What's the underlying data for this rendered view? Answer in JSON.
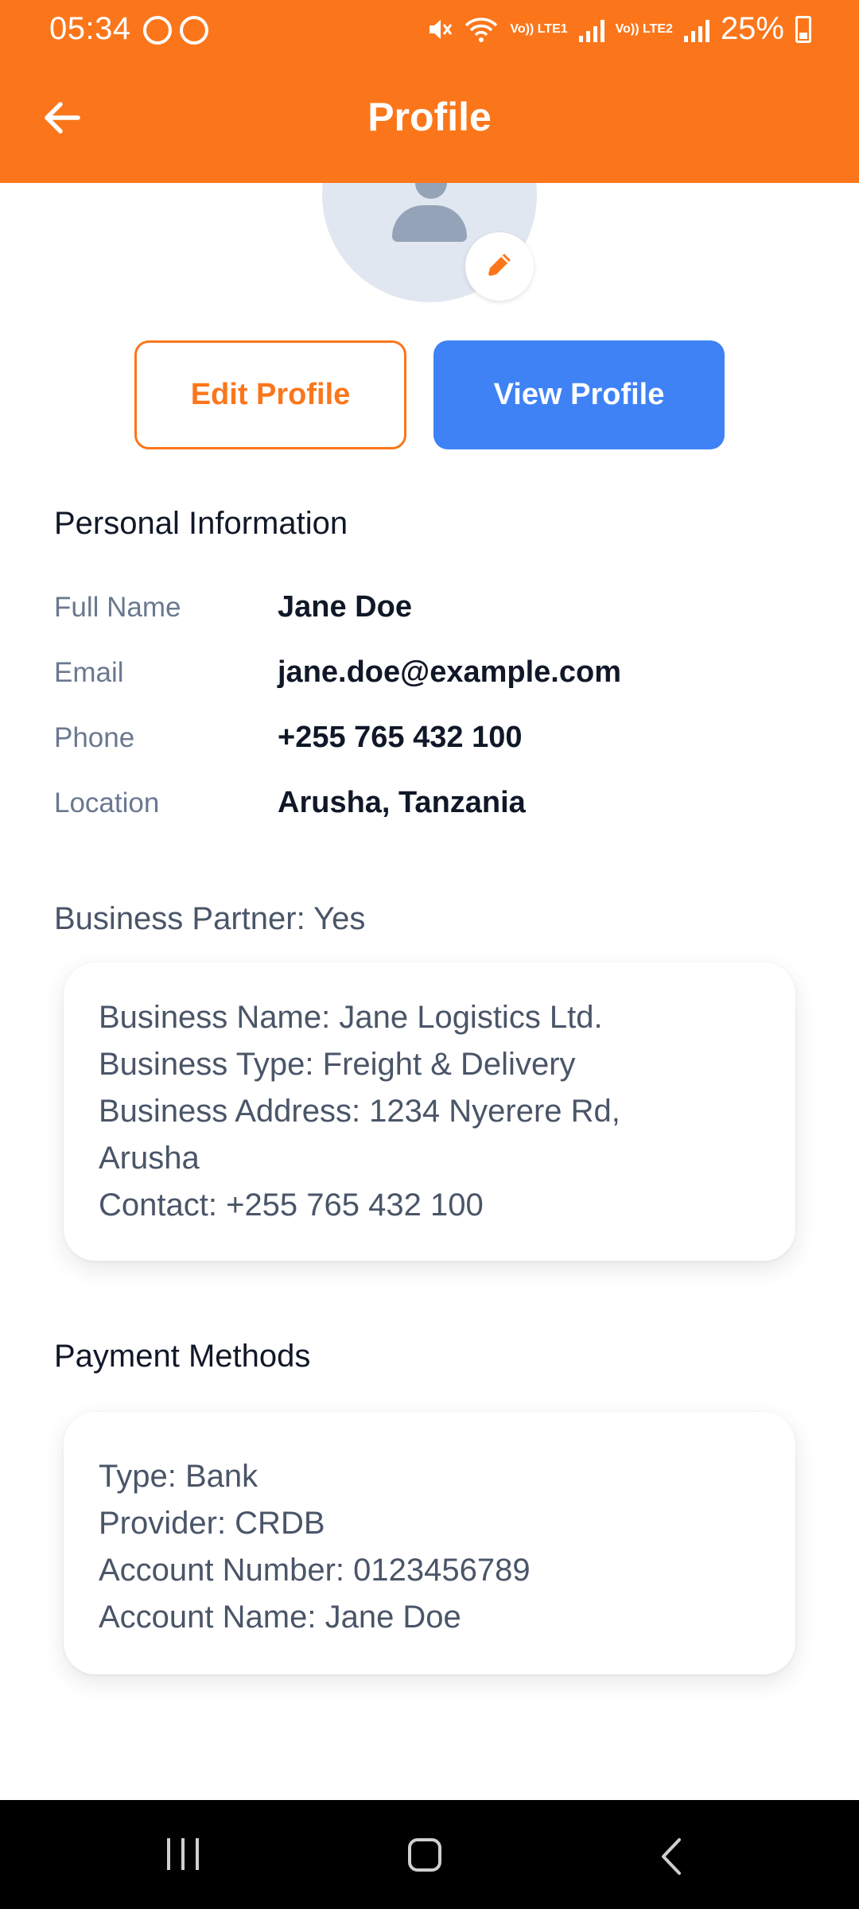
{
  "status_bar": {
    "time": "05:34",
    "battery_percent": "25%",
    "sim1_label": "Vo)) LTE1",
    "sim2_label": "Vo)) LTE2",
    "icons": [
      "screenshot-icon",
      "app-notification-icon",
      "mute-icon",
      "wifi-icon",
      "signal-icon",
      "battery-icon"
    ]
  },
  "header": {
    "title": "Profile",
    "back_icon": "arrow-left-icon",
    "background": "#FB761B"
  },
  "avatar": {
    "placeholder_icon": "user-silhouette-icon",
    "edit_icon": "pencil-icon"
  },
  "actions": {
    "edit_profile_label": "Edit Profile",
    "view_profile_label": "View Profile",
    "accent": "#FB761B",
    "primary": "#3F82F5"
  },
  "personal_information": {
    "title": "Personal Information",
    "rows": [
      {
        "label": "Full Name",
        "value": "Jane Doe"
      },
      {
        "label": "Email",
        "value": "jane.doe@example.com"
      },
      {
        "label": "Phone",
        "value": "+255 765 432 100"
      },
      {
        "label": "Location",
        "value": "Arusha, Tanzania"
      }
    ]
  },
  "business": {
    "partner_line": "Business Partner: Yes",
    "lines": [
      "Business Name: Jane Logistics Ltd.",
      "Business Type: Freight & Delivery",
      "Business Address: 1234 Nyerere Rd,",
      "Arusha",
      "Contact: +255 765 432 100"
    ]
  },
  "payment_methods": {
    "title": "Payment Methods",
    "lines": [
      "Type: Bank",
      "Provider: CRDB",
      "Account Number: 0123456789",
      "Account Name: Jane Doe"
    ]
  },
  "nav_bar": {
    "icons": [
      "recents-icon",
      "home-icon",
      "back-icon"
    ]
  }
}
